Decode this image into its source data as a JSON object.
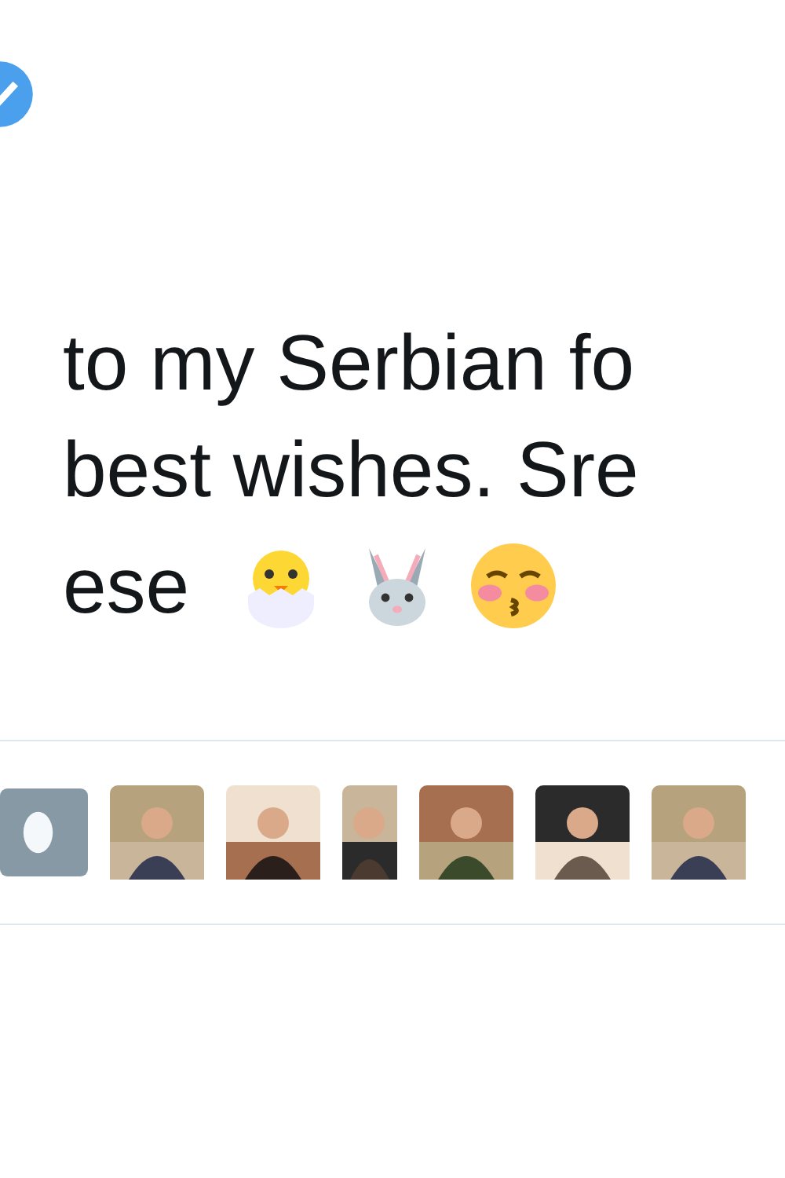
{
  "tweet": {
    "verified": true,
    "lines": [
      "to my Serbian fo",
      "best wishes. Sre",
      "ese"
    ]
  },
  "likers": [
    {
      "kind": "default"
    },
    {
      "kind": "picture"
    },
    {
      "kind": "picture"
    },
    {
      "kind": "narrow"
    },
    {
      "kind": "picture"
    },
    {
      "kind": "picture"
    },
    {
      "kind": "picture"
    }
  ]
}
